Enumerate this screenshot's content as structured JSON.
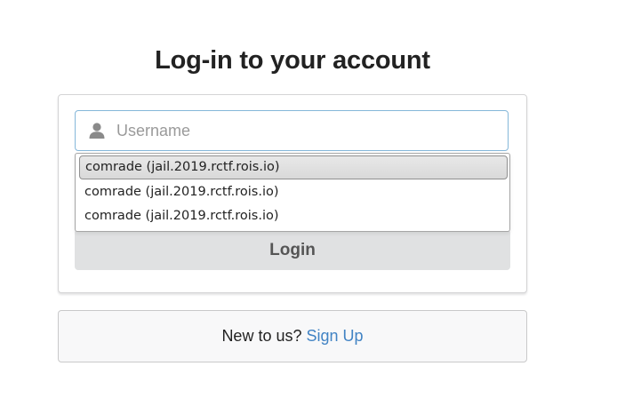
{
  "page": {
    "title": "Log-in to your account"
  },
  "form": {
    "username_placeholder": "Username",
    "username_value": "",
    "login_label": "Login"
  },
  "autocomplete": {
    "items": [
      "comrade (jail.2019.rctf.rois.io)",
      "comrade (jail.2019.rctf.rois.io)",
      "comrade (jail.2019.rctf.rois.io)"
    ],
    "selected_index": 0
  },
  "signup": {
    "prompt": "New to us?",
    "link_label": "Sign Up"
  },
  "icons": {
    "username_icon": "user-icon"
  },
  "colors": {
    "input_focus_border": "#85b7d9",
    "link": "#4183c4",
    "button_bg": "#e0e1e2"
  }
}
